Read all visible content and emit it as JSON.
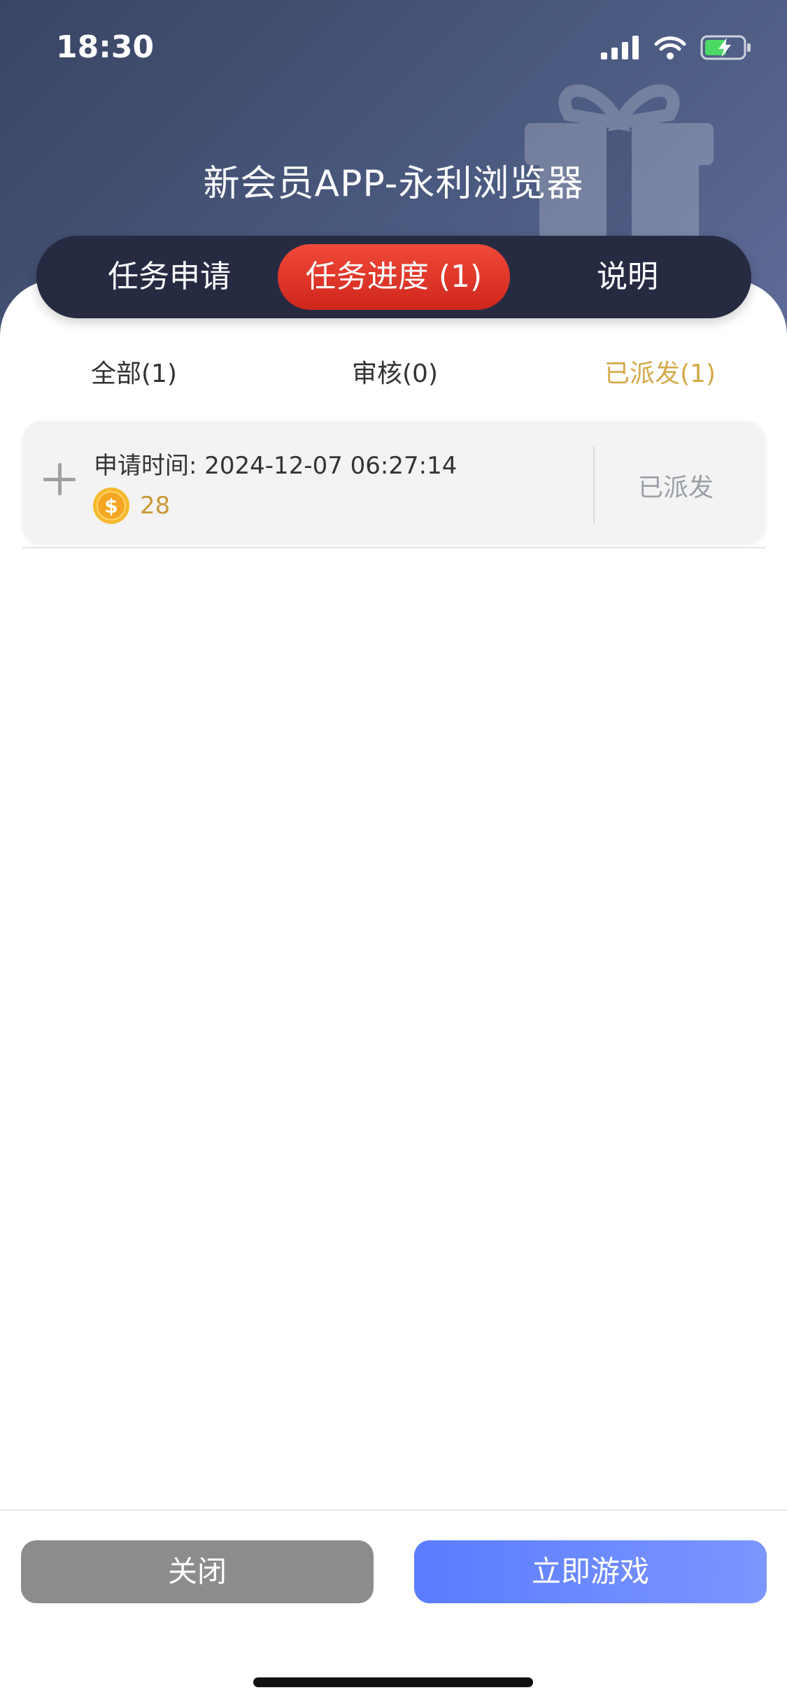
{
  "status_bar": {
    "time": "18:30",
    "icons": [
      "cellular-signal-icon",
      "wifi-icon",
      "battery-charging-icon"
    ]
  },
  "header": {
    "title": "新会员APP-永利浏览器",
    "background_icon": "gift-icon"
  },
  "tabs": [
    {
      "label": "任务申请",
      "active": false
    },
    {
      "label": "任务进度 (1)",
      "active": true
    },
    {
      "label": "说明",
      "active": false
    }
  ],
  "sub_tabs": [
    {
      "label": "全部(1)",
      "active": false
    },
    {
      "label": "审核(0)",
      "active": false
    },
    {
      "label": "已派发(1)",
      "active": true
    }
  ],
  "records": [
    {
      "time_label": "申请时间: 2024-12-07 06:27:14",
      "coin_amount": "28",
      "status": "已派发"
    }
  ],
  "footer": {
    "close_label": "关闭",
    "play_label": "立即游戏"
  },
  "colors": {
    "header_bg": "#3a4563",
    "active_tab": "#e0352b",
    "tab_bar": "#262b42",
    "accent_gold": "#d4a94a",
    "close_button": "#8c8c8c",
    "play_button": "#5b7cff"
  }
}
